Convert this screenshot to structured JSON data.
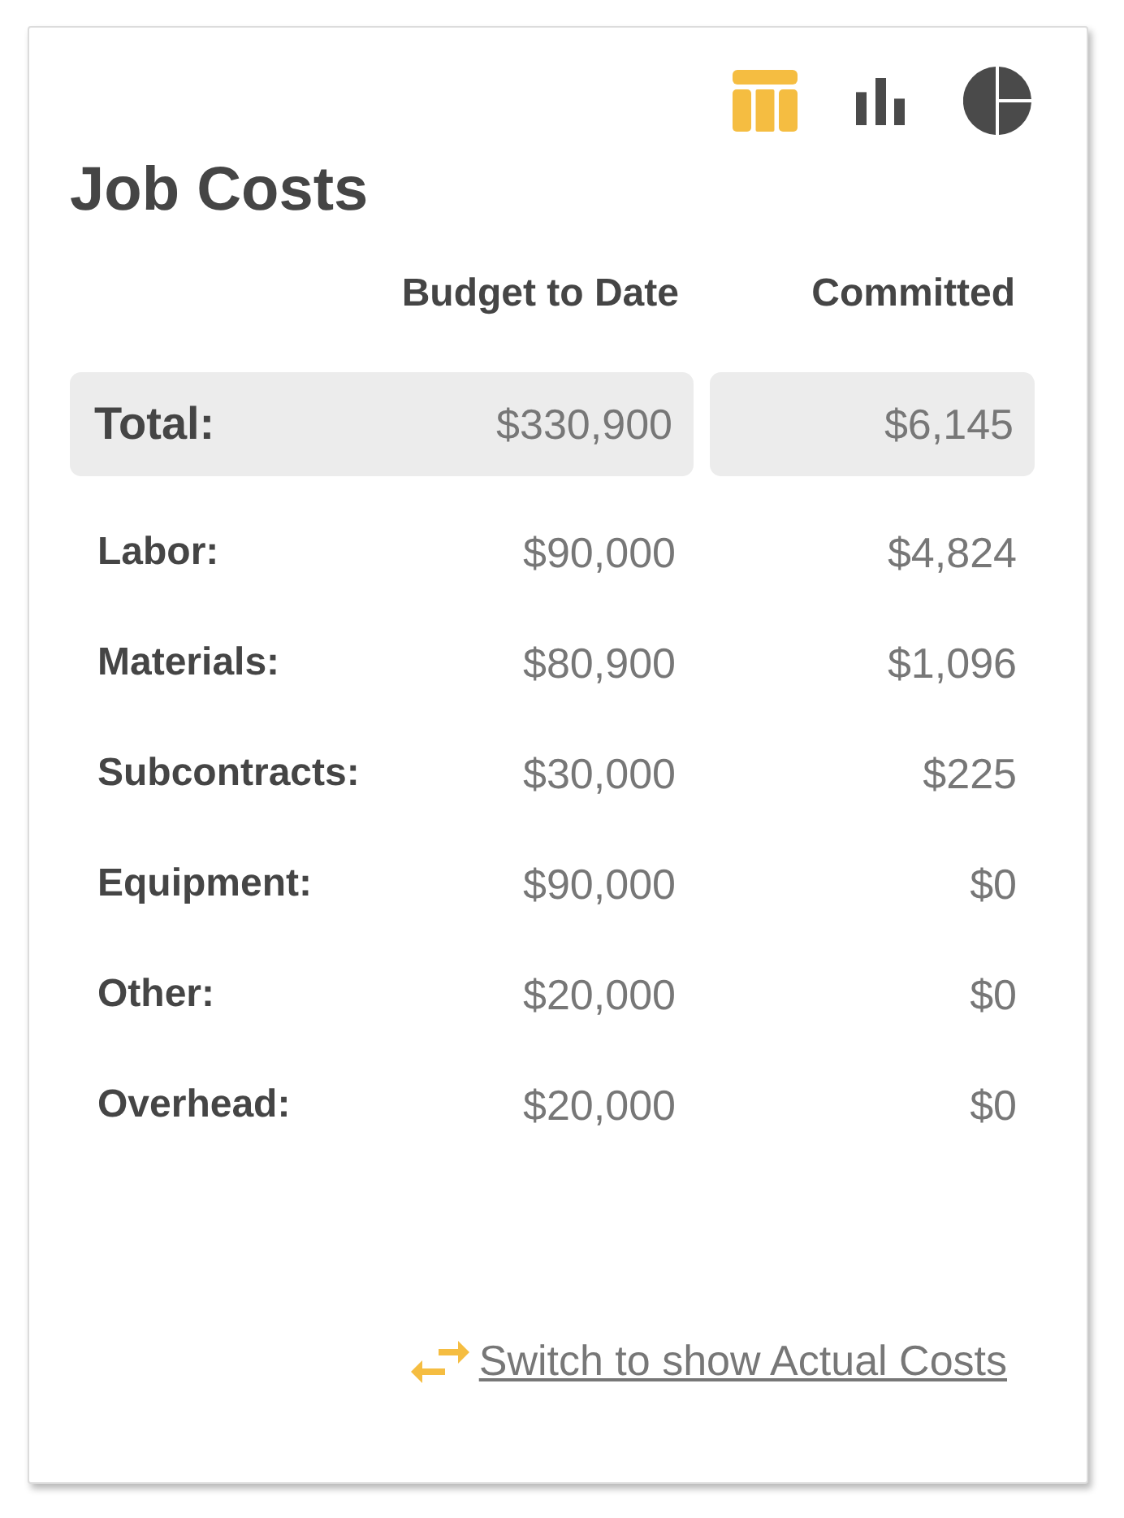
{
  "view_tabs": [
    {
      "kind": "table",
      "selected": true
    },
    {
      "kind": "bar",
      "selected": false
    },
    {
      "kind": "pie",
      "selected": false
    }
  ],
  "title": "Job Costs",
  "table": {
    "columns": [
      "Budget to Date",
      "Committed"
    ],
    "total": {
      "label": "Total:",
      "budget": "$330,900",
      "committed": "$6,145"
    },
    "rows": [
      {
        "label": "Labor:",
        "budget": "$90,000",
        "committed": "$4,824"
      },
      {
        "label": "Materials:",
        "budget": "$80,900",
        "committed": "$1,096"
      },
      {
        "label": "Subcontracts:",
        "budget": "$30,000",
        "committed": "$225"
      },
      {
        "label": "Equipment:",
        "budget": "$90,000",
        "committed": "$0"
      },
      {
        "label": "Other:",
        "budget": "$20,000",
        "committed": "$0"
      },
      {
        "label": "Overhead:",
        "budget": "$20,000",
        "committed": "$0"
      }
    ]
  },
  "switch_link": {
    "text": "Switch to show Actual Costs"
  }
}
